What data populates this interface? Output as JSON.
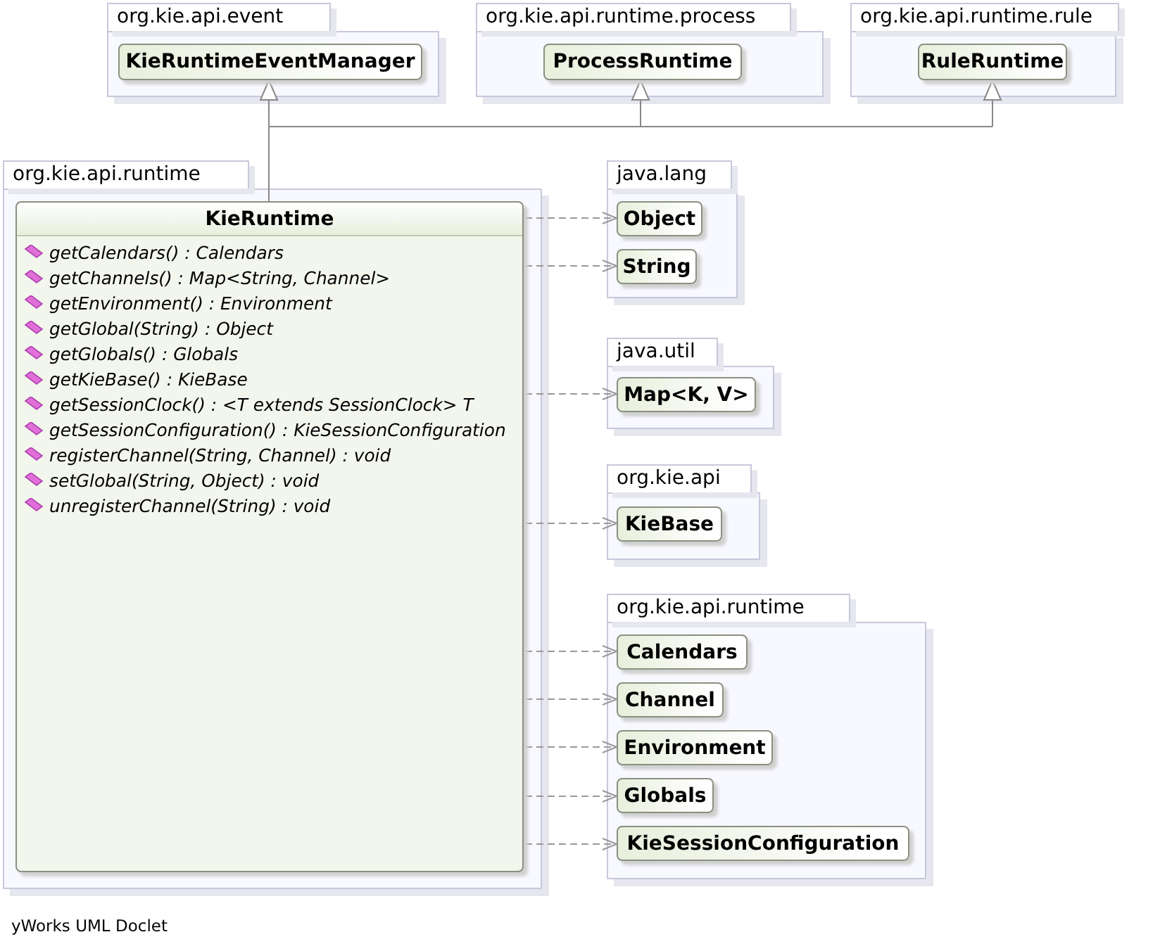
{
  "packages": [
    {
      "name": "org.kie.api.event",
      "classes": [
        {
          "name": "KieRuntimeEventManager"
        }
      ]
    },
    {
      "name": "org.kie.api.runtime.process",
      "classes": [
        {
          "name": "ProcessRuntime"
        }
      ]
    },
    {
      "name": "org.kie.api.runtime.rule",
      "classes": [
        {
          "name": "RuleRuntime"
        }
      ]
    },
    {
      "name": "org.kie.api.runtime",
      "classes": [
        {
          "name": "KieRuntime",
          "methods": [
            {
              "name": "getCalendars()",
              "type": ": Calendars"
            },
            {
              "name": "getChannels()",
              "type": ": Map<String, Channel>"
            },
            {
              "name": "getEnvironment()",
              "type": ": Environment"
            },
            {
              "name": "getGlobal(String)",
              "type": ": Object"
            },
            {
              "name": "getGlobals()",
              "type": ": Globals"
            },
            {
              "name": "getKieBase()",
              "type": ": KieBase"
            },
            {
              "name": "getSessionClock()",
              "type": ": <T extends SessionClock> T"
            },
            {
              "name": "getSessionConfiguration()",
              "type": ": KieSessionConfiguration"
            },
            {
              "name": "registerChannel(String, Channel)",
              "type": ": void"
            },
            {
              "name": "setGlobal(String, Object)",
              "type": ": void"
            },
            {
              "name": "unregisterChannel(String)",
              "type": ": void"
            }
          ]
        }
      ]
    },
    {
      "name": "java.lang",
      "classes": [
        {
          "name": "Object"
        },
        {
          "name": "String"
        }
      ]
    },
    {
      "name": "java.util",
      "classes": [
        {
          "name": "Map<K, V>"
        }
      ]
    },
    {
      "name": "org.kie.api",
      "classes": [
        {
          "name": "KieBase"
        }
      ]
    },
    {
      "name": "org.kie.api.runtime",
      "classes": [
        {
          "name": "Calendars"
        },
        {
          "name": "Channel"
        },
        {
          "name": "Environment"
        },
        {
          "name": "Globals"
        },
        {
          "name": "KieSessionConfiguration"
        }
      ]
    }
  ],
  "footer": "yWorks UML Doclet"
}
